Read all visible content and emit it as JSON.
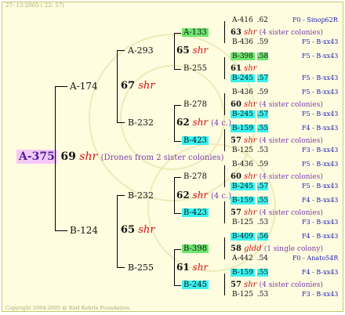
{
  "header": "27- 12-2005 ( 22: 57)",
  "footer": "Copyright 2004-2005 @ Karl Kehrle Foundation.",
  "colors": {
    "green": "#6fe66f",
    "cyan": "#39f3f0",
    "pink": "#f6c8f6"
  },
  "root": {
    "label": "A-375",
    "gen": "69",
    "note": "shr",
    "desc": "(Drones from 2 sister colonies)"
  },
  "g1": [
    {
      "label": "A-174",
      "gen": "67",
      "note": "shr"
    },
    {
      "label": "B-124",
      "gen": "65",
      "note": "shr"
    }
  ],
  "g2": [
    {
      "label": "A-293",
      "gen": "65",
      "note": "shr"
    },
    {
      "label": "B-232",
      "gen": "62",
      "note": "shr",
      "desc": "(4 c.)"
    },
    {
      "label": "B-232",
      "gen": "62",
      "note": "shr",
      "desc": "(4 c.)"
    },
    {
      "label": "B-255",
      "gen": "61",
      "note": "shr"
    }
  ],
  "g3": [
    {
      "label": "A-133",
      "gen": "63",
      "note": "shr",
      "desc": "(4 sister colonies)"
    },
    {
      "label": "B-255",
      "gen": "61",
      "note": "shr"
    },
    {
      "label": "B-278",
      "gen": "60",
      "note": "shr",
      "desc": "(4 sister colonies)"
    },
    {
      "label": "B-423",
      "gen": "57",
      "note": "shr",
      "desc": "(4 sister colonies)"
    },
    {
      "label": "B-278",
      "gen": "60",
      "note": "shr",
      "desc": "(4 sister colonies)"
    },
    {
      "label": "B-423",
      "gen": "57",
      "note": "shr",
      "desc": "(4 sister colonies)"
    },
    {
      "label": "B-398",
      "gen": "58",
      "note": "gldd",
      "desc": "(1 single colony)"
    },
    {
      "label": "B-245",
      "gen": "57",
      "note": "shr",
      "desc": "(4 sister colonies)"
    }
  ],
  "g4": [
    {
      "label": "A-416",
      "value": ".62",
      "src": "F0 - Sinop62R"
    },
    {
      "label": "B-436",
      "value": ".59",
      "src": "F5 - B-xx43"
    },
    {
      "label": "B-398",
      "value": ".58",
      "src": "F5 - B-xx43"
    },
    {
      "label": "B-245",
      "value": ".57",
      "src": "F5 - B-xx43"
    },
    {
      "label": "B-436",
      "value": ".59",
      "src": "F5 - B-xx43"
    },
    {
      "label": "B-245",
      "value": ".57",
      "src": "F5 - B-xx43"
    },
    {
      "label": "B-159",
      "value": ".55",
      "src": "F4 - B-xx43"
    },
    {
      "label": "B-125",
      "value": ".53",
      "src": "F3 - B-xx43"
    },
    {
      "label": "B-436",
      "value": ".59",
      "src": "F5 - B-xx43"
    },
    {
      "label": "B-245",
      "value": ".57",
      "src": "F5 - B-xx43"
    },
    {
      "label": "B-159",
      "value": ".55",
      "src": "F4 - B-xx43"
    },
    {
      "label": "B-125",
      "value": ".53",
      "src": "F3 - B-xx43"
    },
    {
      "label": "B-409",
      "value": ".56",
      "src": "F4 - B-xx43"
    },
    {
      "label": "A-442",
      "value": ".54",
      "src": "F0 - Anato54R"
    },
    {
      "label": "B-159",
      "value": ".55",
      "src": "F4 - B-xx43"
    },
    {
      "label": "B-125",
      "value": ".53",
      "src": "F3 - B-xx43"
    }
  ]
}
